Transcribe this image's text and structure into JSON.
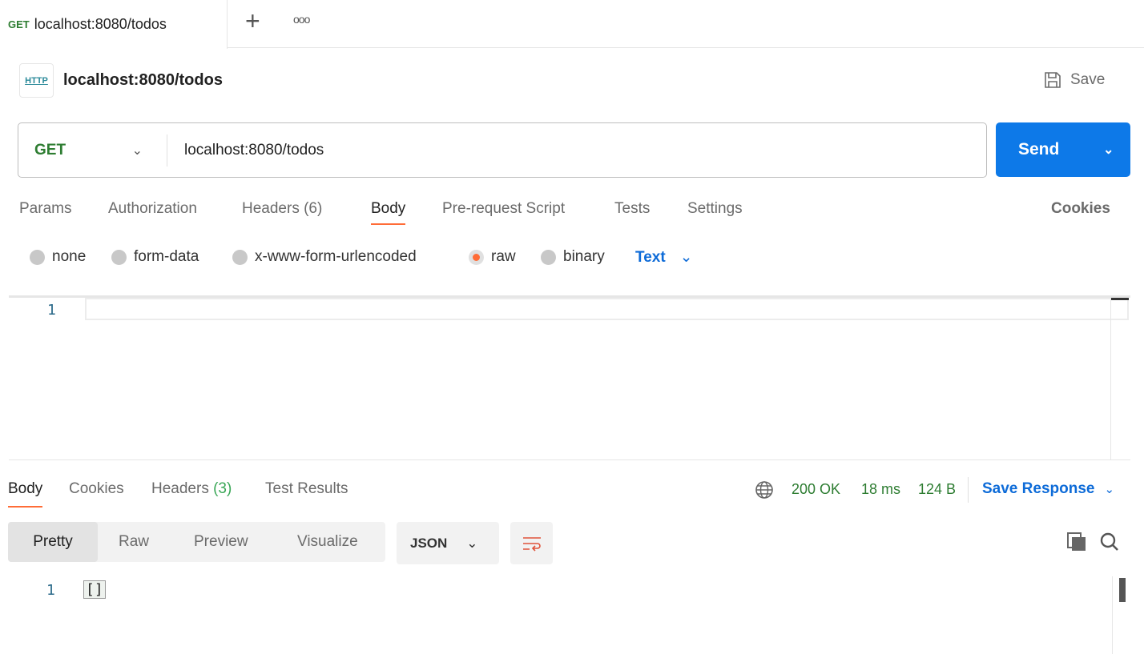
{
  "tab": {
    "method": "GET",
    "title": "localhost:8080/todos",
    "new_tab": "+",
    "more": "ooo"
  },
  "header": {
    "icon_text": "HTTP",
    "title": "localhost:8080/todos",
    "save": "Save"
  },
  "request": {
    "method": "GET",
    "url": "localhost:8080/todos",
    "send": "Send"
  },
  "req_tabs": [
    {
      "label": "Params"
    },
    {
      "label": "Authorization"
    },
    {
      "label": "Headers",
      "count": "(6)"
    },
    {
      "label": "Body"
    },
    {
      "label": "Pre-request Script"
    },
    {
      "label": "Tests"
    },
    {
      "label": "Settings"
    }
  ],
  "cookies": "Cookies",
  "body_types": [
    "none",
    "form-data",
    "x-www-form-urlencoded",
    "raw",
    "binary"
  ],
  "body_format": "Text",
  "editor": {
    "line": "1"
  },
  "resp_tabs": [
    {
      "label": "Body"
    },
    {
      "label": "Cookies"
    },
    {
      "label": "Headers",
      "count": "(3)"
    },
    {
      "label": "Test Results"
    }
  ],
  "status": {
    "code": "200 OK",
    "time": "18 ms",
    "size": "124 B",
    "save_response": "Save Response"
  },
  "view_modes": [
    "Pretty",
    "Raw",
    "Preview",
    "Visualize"
  ],
  "resp_format": "JSON",
  "response": {
    "line": "1",
    "content": "[]"
  },
  "colors": {
    "accent": "#ff6c37",
    "send": "#0d79e8",
    "ok": "#2e7d32"
  }
}
